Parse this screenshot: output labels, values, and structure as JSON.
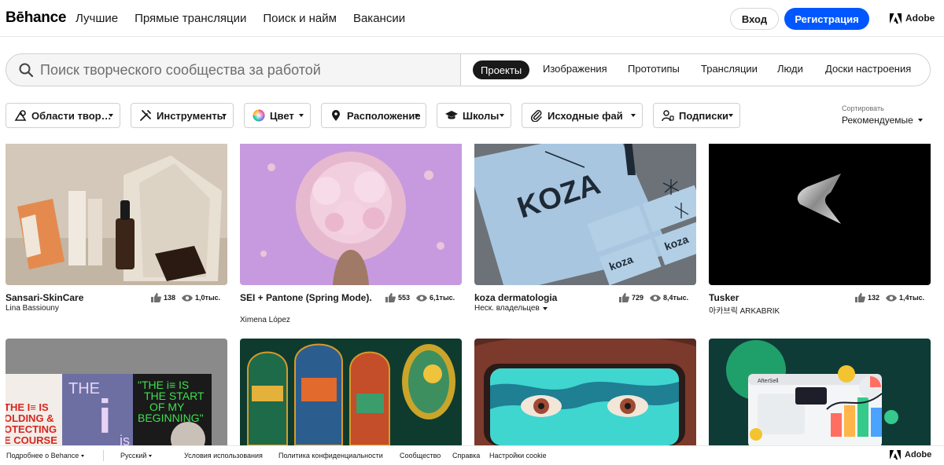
{
  "header": {
    "logo": "Bēhance",
    "nav": [
      "Лучшие",
      "Прямые трансляции",
      "Поиск и найм",
      "Вакансии"
    ],
    "login": "Вход",
    "signup": "Регистрация",
    "adobe": "Adobe",
    "accent": "#0057ff"
  },
  "search": {
    "placeholder": "Поиск творческого сообщества за работой",
    "tabs": [
      "Проекты",
      "Изображения",
      "Прототипы",
      "Трансляции",
      "Люди",
      "Доски настроения"
    ],
    "active_tab": "Проекты"
  },
  "filters": {
    "items": [
      {
        "label": "Области твор…",
        "icon": "creative-fields-icon"
      },
      {
        "label": "Инструменты",
        "icon": "tools-icon"
      },
      {
        "label": "Цвет",
        "icon": "color-wheel-icon"
      },
      {
        "label": "Расположение",
        "icon": "location-pin-icon"
      },
      {
        "label": "Школы",
        "icon": "graduation-cap-icon"
      },
      {
        "label": "Исходные фай",
        "icon": "paperclip-icon"
      },
      {
        "label": "Подписки",
        "icon": "subscriptions-icon"
      }
    ],
    "sort_label": "Сортировать",
    "sort_value": "Рекомендуемые"
  },
  "cards": [
    {
      "title": "Sansari-SkinCare",
      "author": "Lina Bassiouny",
      "likes": "138",
      "views": "1,0тыс."
    },
    {
      "title": "SEI + Pantone (Spring Mode).",
      "author": "Ximena López",
      "likes": "553",
      "views": "6,1тыс."
    },
    {
      "title": "koza dermatologia",
      "author": "Неск. владельцев",
      "likes": "729",
      "views": "8,4тыс."
    },
    {
      "title": "Tusker",
      "author": "아카브릭 ARKABRIK",
      "likes": "132",
      "views": "1,4тыс."
    }
  ],
  "thumb_text": {
    "koza": "KOZA",
    "koza_small": "koza",
    "vinyl_the": "THE",
    "vinyl_i": "i",
    "vinyl_is": "is",
    "vinyl_left": "THE IS\nOLDING &\nOTECTING\nE COURSE",
    "vinyl_green": "\"THE i IS\nTHE START\nOF MY\nBEGINNING\"",
    "aftersell": "AfterSell"
  },
  "footer": {
    "about": "Подробнее о Behance",
    "language": "Русский",
    "links": [
      "Условия использования",
      "Политика конфиденциальности",
      "Сообщество",
      "Справка",
      "Настройки cookie"
    ],
    "adobe": "Adobe"
  }
}
